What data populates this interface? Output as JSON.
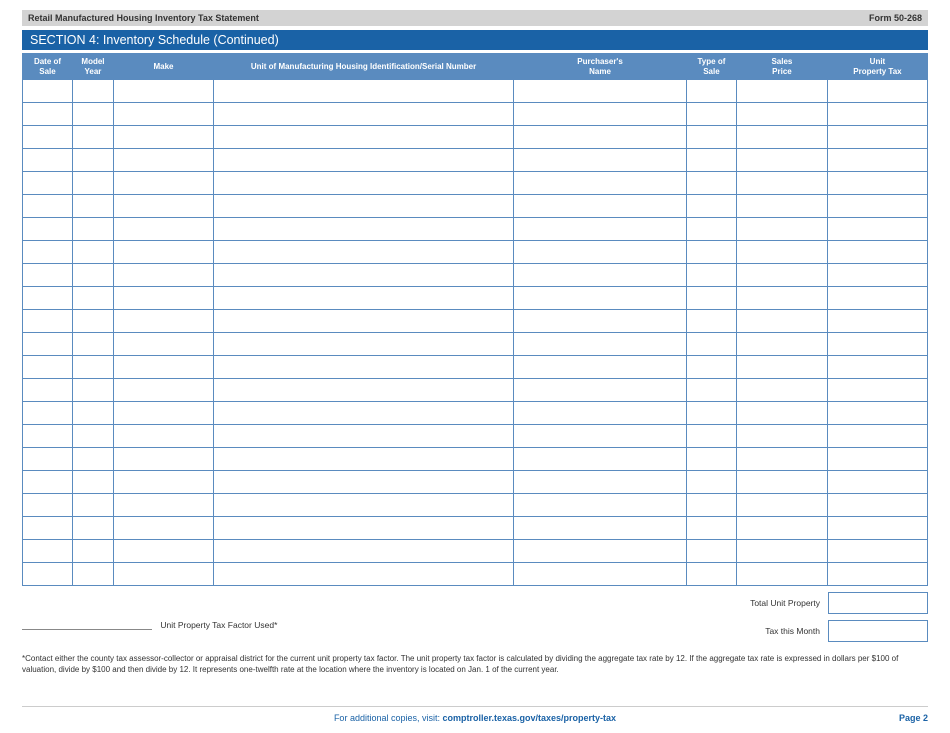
{
  "header": {
    "title": "Retail Manufactured Housing Inventory Tax Statement",
    "form": "Form 50-268"
  },
  "section": {
    "title": "SECTION 4: Inventory Schedule (Continued)"
  },
  "table": {
    "headers": {
      "date": "Date of\nSale",
      "year": "Model\nYear",
      "make": "Make",
      "unitid": "Unit of Manufacturing Housing Identification/Serial Number",
      "purchaser": "Purchaser's\nName",
      "type": "Type of\nSale",
      "price": "Sales\nPrice",
      "tax": "Unit\nProperty Tax"
    },
    "row_count": 22
  },
  "totals": {
    "total_unit_property": "Total Unit Property",
    "tax_this_month": "Tax this Month",
    "factor_label": "Unit Property Tax Factor Used*"
  },
  "footnote": "*Contact either the county tax assessor-collector or appraisal district for the current unit property tax factor. The unit property tax factor is calculated by dividing the aggregate tax rate by 12. If the aggregate tax rate is expressed in dollars per $100 of valuation, divide by $100 and then divide by 12. It represents one-twelfth rate at the location where the inventory is located on Jan. 1 of the current year.",
  "footer": {
    "prefix": "For additional copies, visit: ",
    "link": "comptroller.texas.gov/taxes/property-tax",
    "page": "Page 2"
  }
}
